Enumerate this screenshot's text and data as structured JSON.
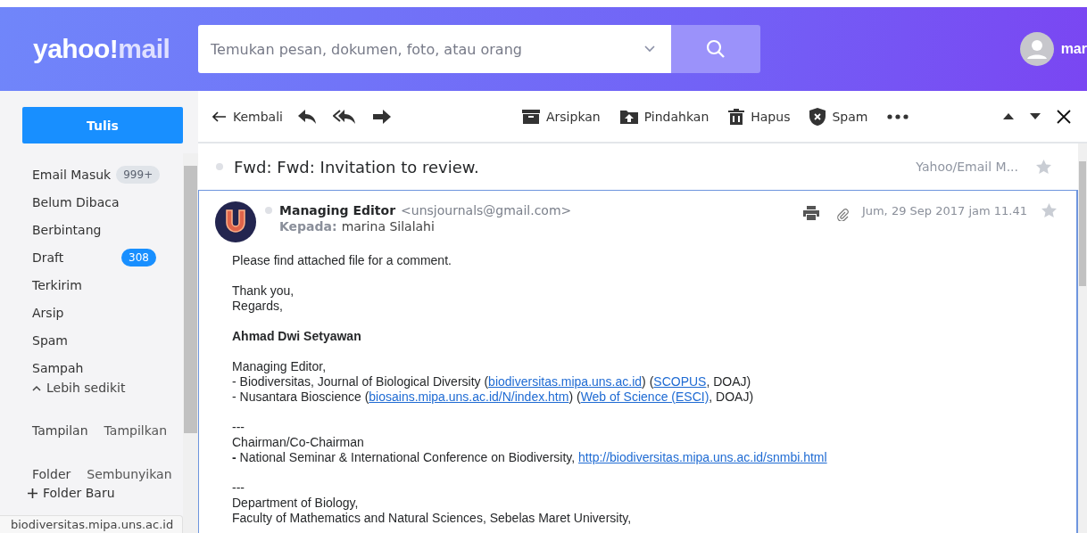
{
  "header": {
    "logo": {
      "brand": "yahoo!",
      "product": "mail"
    },
    "search": {
      "placeholder": "Temukan pesan, dokumen, foto, atau orang"
    },
    "user": {
      "name": "mar"
    }
  },
  "sidebar": {
    "compose": "Tulis",
    "items": [
      {
        "label": "Email Masuk",
        "count": "999+",
        "highlight": false
      },
      {
        "label": "Belum Dibaca"
      },
      {
        "label": "Berbintang"
      },
      {
        "label": "Draft",
        "count": "308",
        "highlight": true
      },
      {
        "label": "Terkirim"
      },
      {
        "label": "Arsip"
      },
      {
        "label": "Spam"
      },
      {
        "label": "Sampah"
      }
    ],
    "less": "Lebih sedikit",
    "sections": [
      {
        "title": "Tampilan",
        "action": "Tampilkan"
      },
      {
        "title": "Folder",
        "action": "Sembunyikan"
      }
    ],
    "new_folder": "Folder Baru"
  },
  "toolbar": {
    "back": "Kembali",
    "actions": [
      {
        "kind": "archive",
        "label": "Arsipkan"
      },
      {
        "kind": "move",
        "label": "Pindahkan"
      },
      {
        "kind": "delete",
        "label": "Hapus"
      },
      {
        "kind": "spam",
        "label": "Spam"
      }
    ]
  },
  "message": {
    "subject": "Fwd: Fwd: Invitation to review.",
    "folder": "Yahoo/Email M...",
    "sender": "Managing Editor",
    "email": "<unsjournals@gmail.com>",
    "to_label": "Kepada:",
    "to": "marina Silalahi",
    "date": "Jum, 29 Sep 2017 jam 11.41",
    "paragraphs": [
      [
        {
          "kind": "text",
          "parts": [
            {
              "text": "Please find attached file for a comment.",
              "link": false
            }
          ]
        }
      ],
      [
        {
          "kind": "text",
          "parts": [
            {
              "text": "Thank you,",
              "link": false
            }
          ]
        },
        {
          "kind": "text",
          "parts": [
            {
              "text": "Regards,",
              "link": false
            }
          ]
        }
      ],
      [
        {
          "kind": "name",
          "parts": [
            {
              "text": "Ahmad Dwi Setyawan",
              "link": false
            }
          ]
        }
      ],
      [
        {
          "kind": "text",
          "parts": [
            {
              "text": "Managing Editor,",
              "link": false
            }
          ]
        },
        {
          "kind": "text",
          "parts": [
            {
              "text": "- Biodiversitas, Journal of Biological Diversity (",
              "link": false
            },
            {
              "text": "biodiversitas.mipa.uns.ac.id",
              "link": true
            },
            {
              "text": ") (",
              "link": false
            },
            {
              "text": "SCOPUS",
              "link": true
            },
            {
              "text": ", DOAJ)",
              "link": false
            }
          ]
        },
        {
          "kind": "text",
          "parts": [
            {
              "text": "- Nusantara Bioscience (",
              "link": false
            },
            {
              "text": "biosains.mipa.uns.ac.id/N/index.htm",
              "link": true
            },
            {
              "text": ") (",
              "link": false
            },
            {
              "text": "Web of Science (ESCI)",
              "link": true
            },
            {
              "text": ", DOAJ)",
              "link": false
            }
          ]
        }
      ],
      [
        {
          "kind": "text",
          "parts": [
            {
              "text": "---",
              "link": false
            }
          ]
        },
        {
          "kind": "text",
          "parts": [
            {
              "text": "Chairman/Co-Chairman",
              "link": false
            }
          ]
        },
        {
          "kind": "text",
          "parts": [
            {
              "text": "**-** National Seminar & International Conference on Biodiversity, ",
              "link": false
            },
            {
              "text": "http://biodiversitas.mipa.uns.ac.id/snmbi.html",
              "link": true
            }
          ]
        }
      ],
      [
        {
          "kind": "text",
          "parts": [
            {
              "text": "---",
              "link": false
            }
          ]
        },
        {
          "kind": "text",
          "parts": [
            {
              "text": "Department of Biology,",
              "link": false
            }
          ]
        },
        {
          "kind": "text",
          "parts": [
            {
              "text": "Faculty of Mathematics and Natural Sciences, Sebelas Maret University,",
              "link": false
            }
          ]
        }
      ]
    ]
  },
  "status_bar": "biodiversitas.mipa.uns.ac.id"
}
